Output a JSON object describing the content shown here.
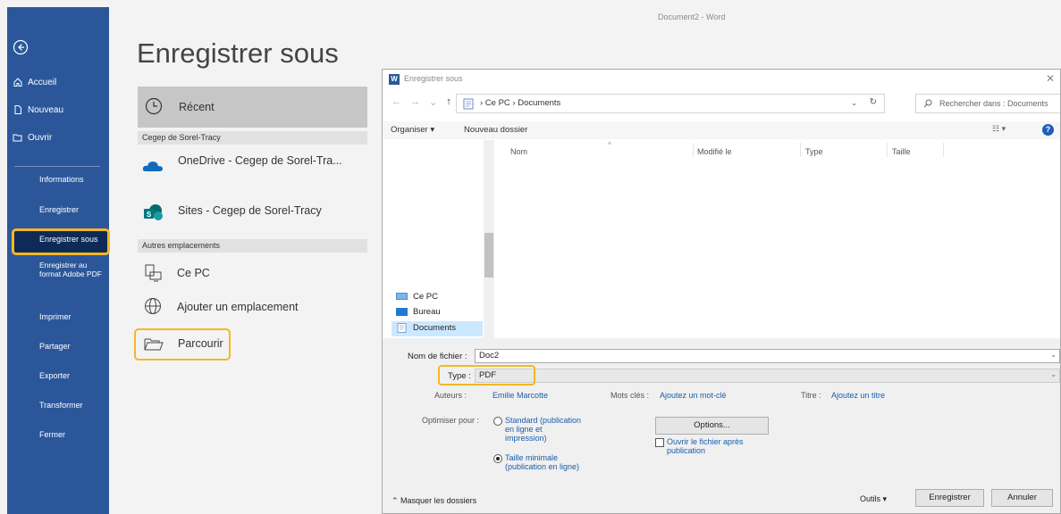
{
  "window": {
    "title": "Document2 - Word"
  },
  "nav": {
    "top_items": [
      "Accueil",
      "Nouveau",
      "Ouvrir"
    ],
    "items": [
      "Informations",
      "Enregistrer",
      "Enregistrer sous",
      "Enregistrer au format Adobe PDF",
      "Imprimer",
      "Partager",
      "Exporter",
      "Transformer",
      "Fermer"
    ],
    "selected": "Enregistrer sous"
  },
  "backstage": {
    "title": "Enregistrer sous",
    "recent": "Récent",
    "section1": "Cegep de Sorel-Tracy",
    "onedrive": "OneDrive - Cegep de Sorel-Tra...",
    "sites": "Sites - Cegep de Sorel-Tracy",
    "section2": "Autres emplacements",
    "ce_pc": "Ce PC",
    "add_location": "Ajouter un emplacement",
    "browse": "Parcourir"
  },
  "dialog": {
    "title": "Enregistrer sous",
    "breadcrumb": "›  Ce PC  ›  Documents",
    "search_placeholder": "Rechercher dans : Documents",
    "organize": "Organiser ▾",
    "new_folder": "Nouveau dossier",
    "columns": [
      "Nom",
      "Modifié le",
      "Type",
      "Taille"
    ],
    "tree": [
      "Ce PC",
      "Bureau",
      "Documents"
    ],
    "filename_label": "Nom de fichier :",
    "filename_value": "Doc2",
    "type_label": "Type :",
    "type_value": "PDF",
    "authors_label": "Auteurs :",
    "authors_value": "Emilie Marcotte",
    "keywords_label": "Mots clés :",
    "keywords_value": "Ajoutez un mot-clé",
    "title_label": "Titre :",
    "title_value": "Ajoutez un titre",
    "optimize_label": "Optimiser pour :",
    "opt_standard_lines": [
      "Standard (publication",
      "en ligne et",
      "impression)"
    ],
    "opt_min_lines": [
      "Taille minimale",
      "(publication en ligne)"
    ],
    "options_button": "Options...",
    "open_after_lines": [
      "Ouvrir le fichier après",
      "publication"
    ],
    "hide_folders": "Masquer les dossiers",
    "tools": "Outils",
    "save": "Enregistrer",
    "cancel": "Annuler"
  },
  "colors": {
    "nav_blue": "#2b579a",
    "highlight": "#f4b825",
    "link": "#1a5dab"
  }
}
